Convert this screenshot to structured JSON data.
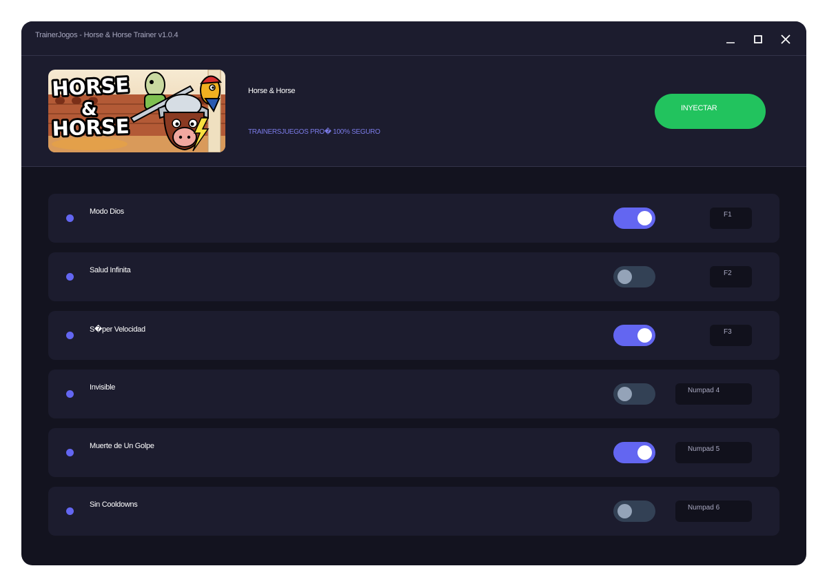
{
  "window": {
    "title": "TrainerJogos - Horse & Horse Trainer v1.0.4",
    "controls": [
      "minimize-icon",
      "maximize-icon",
      "close-icon"
    ]
  },
  "header": {
    "game_title": "Horse & Horse",
    "subtitle": "TRAINERSJUEGOS PRO� 100% SEGURO",
    "inject_label": "INYECTAR",
    "banner_logo_text": "HORSE & HORSE"
  },
  "colors": {
    "accent": "#6366f1",
    "inject": "#22c35e",
    "panel": "#1c1c2e",
    "background": "#13131f",
    "toggle_off": "#334155"
  },
  "cheats": [
    {
      "label": "Modo Dios",
      "enabled": true,
      "hotkey": "F1"
    },
    {
      "label": "Salud Infinita",
      "enabled": false,
      "hotkey": "F2"
    },
    {
      "label": "S�per Velocidad",
      "enabled": true,
      "hotkey": "F3"
    },
    {
      "label": "Invisible",
      "enabled": false,
      "hotkey": "Numpad 4"
    },
    {
      "label": "Muerte de Un Golpe",
      "enabled": true,
      "hotkey": "Numpad 5"
    },
    {
      "label": "Sin Cooldowns",
      "enabled": false,
      "hotkey": "Numpad 6"
    }
  ]
}
